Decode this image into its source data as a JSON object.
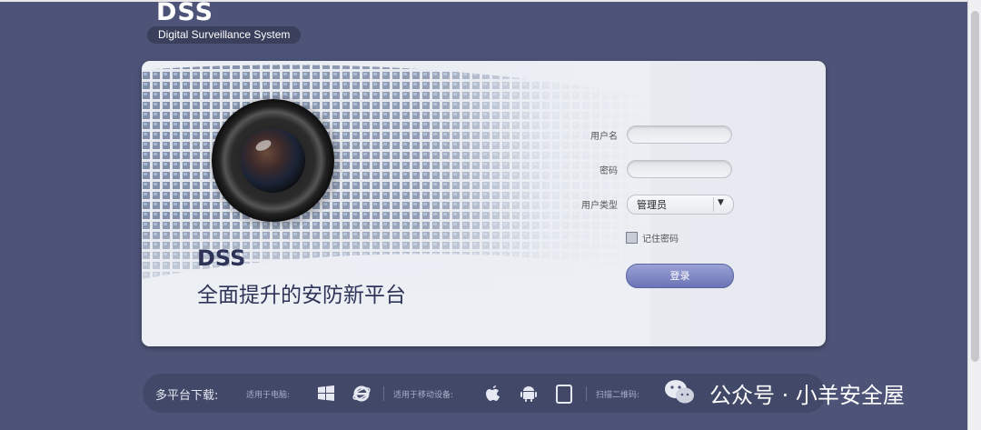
{
  "brand": {
    "name": "DSS",
    "tagline": "Digital Surveillance System"
  },
  "hero": {
    "title": "DSS",
    "subtitle": "全面提升的安防新平台"
  },
  "login": {
    "username_label": "用户名",
    "username_value": "",
    "password_label": "密码",
    "password_value": "",
    "user_type_label": "用户类型",
    "user_type_value": "管理员",
    "remember_label": "记住密码",
    "remember_checked": false,
    "submit_label": "登录"
  },
  "footer": {
    "download_label": "多平台下载:",
    "pc_label": "适用于电脑:",
    "mobile_label": "适用于移动设备:",
    "qr_label": "扫描二维码:",
    "icons": [
      "windows-icon",
      "ie-icon",
      "apple-icon",
      "android-icon",
      "tablet-icon"
    ]
  },
  "watermark": {
    "text": "公众号 · 小羊安全屋"
  },
  "colors": {
    "background": "#4d5478",
    "card": "#eceff4",
    "accent": "#6b74b6",
    "heading": "#2e3458"
  }
}
